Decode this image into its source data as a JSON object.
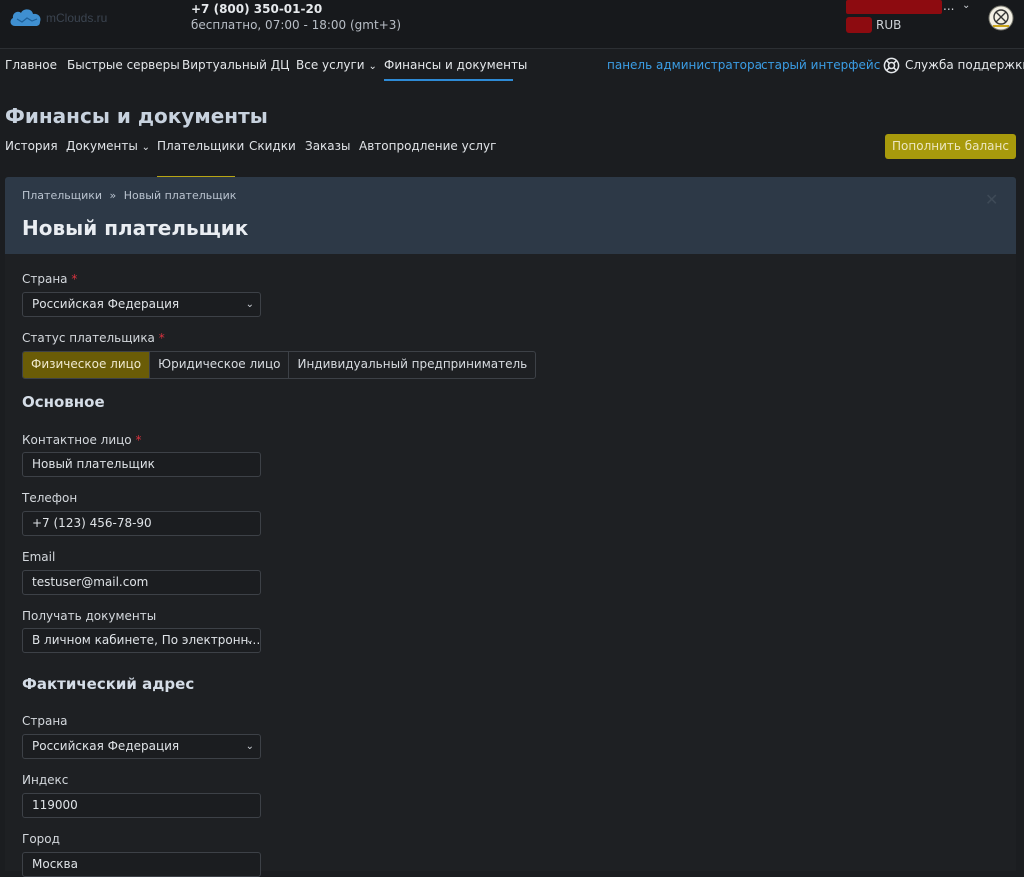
{
  "header": {
    "logo_text": "mClouds.ru",
    "phone": "+7 (800) 350-01-20",
    "hours": "бесплатно, 07:00 - 18:00 (gmt+3)",
    "account_ellipsis": "...",
    "balance_currency": "RUB"
  },
  "nav": {
    "items": [
      "Главное",
      "Быстрые серверы",
      "Виртуальный ДЦ",
      "Все услуги",
      "Финансы и документы"
    ],
    "admin_panel": "панель администратора",
    "old_interface": "старый интерфейс",
    "support": "Служба поддержки"
  },
  "page": {
    "title": "Финансы и документы",
    "subnav": [
      "История",
      "Документы",
      "Плательщики",
      "Скидки",
      "Заказы",
      "Автопродление услуг"
    ],
    "topup_button": "Пополнить баланс"
  },
  "panel": {
    "breadcrumb_root": "Плательщики",
    "breadcrumb_sep": "»",
    "breadcrumb_current": "Новый плательщик",
    "title": "Новый плательщик",
    "close": "✕"
  },
  "form": {
    "country_label": "Страна",
    "country_value": "Российская Федерация",
    "status_label": "Статус плательщика",
    "status_options": [
      "Физическое лицо",
      "Юридическое лицо",
      "Индивидуальный предприниматель"
    ],
    "status_selected": "Физическое лицо",
    "section_main": "Основное",
    "contact_label": "Контактное лицо",
    "contact_value": "Новый плательщик",
    "phone_label": "Телефон",
    "phone_value": "+7 (123) 456-78-90",
    "email_label": "Email",
    "email_value": "testuser@mail.com",
    "docs_label": "Получать документы",
    "docs_value": "В личном кабинете, По электронн…",
    "section_address": "Фактический адрес",
    "addr_country_label": "Страна",
    "addr_country_value": "Российская Федерация",
    "index_label": "Индекс",
    "index_value": "119000",
    "city_label": "Город",
    "city_value": "Москва"
  },
  "colors": {
    "accent_blue": "#2e8bd6",
    "accent_gold": "#a89a0c",
    "panel_header": "#2d3947",
    "required": "#d9333f"
  }
}
